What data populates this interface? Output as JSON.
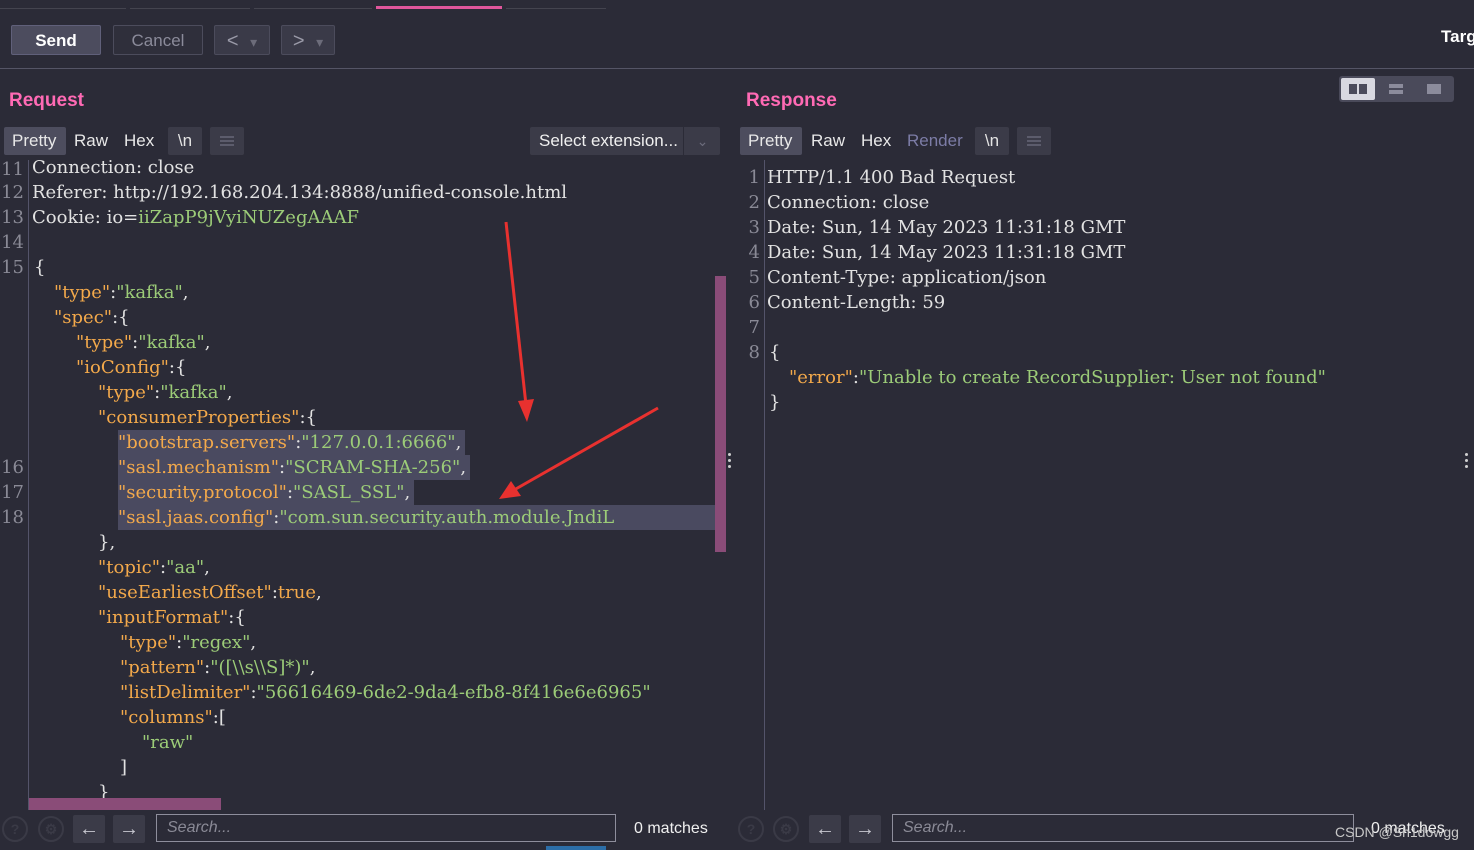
{
  "toolbar": {
    "send_label": "Send",
    "cancel_label": "Cancel",
    "back_label": "<",
    "forward_label": ">",
    "dropdown_glyph": "▾",
    "target_label": "Targ"
  },
  "request": {
    "title": "Request",
    "tabs": {
      "pretty": "Pretty",
      "raw": "Raw",
      "hex": "Hex",
      "newline": "\\n"
    },
    "select_extension": "Select extension...",
    "gutter": [
      "11",
      "12",
      "13",
      "14",
      "15",
      "16",
      "17",
      "18"
    ],
    "lines": {
      "l11a": "Connection: ",
      "l11b": "close",
      "l12a": "Referer: ",
      "l12b": "http://192.168.204.134:8888/unified-console.html",
      "l13a": "Cookie: ",
      "l13b": "io=",
      "l13c": "iiZapP9jVyiNUZegAAAF",
      "l15": "{",
      "type_key": "\"type\"",
      "colon": ":",
      "kafka_val": "\"kafka\"",
      "comma": ",",
      "spec_key": "\"spec\"",
      "open_brace": "{",
      "ioconfig_key": "\"ioConfig\"",
      "consumer_key": "\"consumerProperties\"",
      "bootstrap_key": "\"bootstrap.servers\"",
      "bootstrap_val": "\"127.0.0.1:6666\"",
      "mech_key": "\"sasl.mechanism\"",
      "mech_val": "\"SCRAM-SHA-256\"",
      "proto_key": "\"security.protocol\"",
      "proto_val": "\"SASL_SSL\"",
      "jaas_key": "\"sasl.jaas.config\"",
      "jaas_val": "\"com.sun.security.auth.module.JndiL",
      "close_brace_comma": "},",
      "topic_key": "\"topic\"",
      "topic_val": "\"aa\"",
      "earliest_key": "\"useEarliestOffset\"",
      "earliest_val": "true",
      "input_key": "\"inputFormat\"",
      "regex_val": "\"regex\"",
      "pattern_key": "\"pattern\"",
      "pattern_val": "\"([\\\\s\\\\S]*)\"",
      "delim_key": "\"listDelimiter\"",
      "delim_val": "\"56616469-6de2-9da4-efb8-8f416e6e6965\"",
      "columns_key": "\"columns\"",
      "open_bracket": "[",
      "raw_val": "\"raw\"",
      "close_bracket": "]",
      "close_brace": "}"
    },
    "search_placeholder": "Search...",
    "matches": "0 matches"
  },
  "response": {
    "title": "Response",
    "tabs": {
      "pretty": "Pretty",
      "raw": "Raw",
      "hex": "Hex",
      "render": "Render",
      "newline": "\\n"
    },
    "gutter": [
      "1",
      "2",
      "3",
      "4",
      "5",
      "6",
      "7",
      "8"
    ],
    "lines": {
      "l1": "HTTP/1.1 400 Bad Request",
      "l2a": "Connection: ",
      "l2b": "close",
      "l3a": "Date: ",
      "l3b": "Sun, 14 May 2023 11:31:18 GMT",
      "l4a": "Date: ",
      "l4b": "Sun, 14 May 2023 11:31:18 GMT",
      "l5a": "Content-Type: ",
      "l5b": "application/json",
      "l6a": "Content-Length: ",
      "l6b": "59",
      "l8": "{",
      "error_key": "\"error\"",
      "colon": ":",
      "error_val": "\"Unable to create RecordSupplier: User not found\"",
      "close": "}"
    },
    "search_placeholder": "Search...",
    "matches": "0 matches"
  },
  "watermark": "CSDN @Sh1dowgg",
  "colors": {
    "background": "#2b2b37",
    "accent_pink": "#ff6ab4",
    "string_green": "#9ccc78",
    "key_orange": "#f3a94b",
    "annotation_red": "#e8312f"
  },
  "icons": [
    "help-icon",
    "settings-icon",
    "back-arrow-icon",
    "forward-arrow-icon",
    "menu-icon"
  ]
}
